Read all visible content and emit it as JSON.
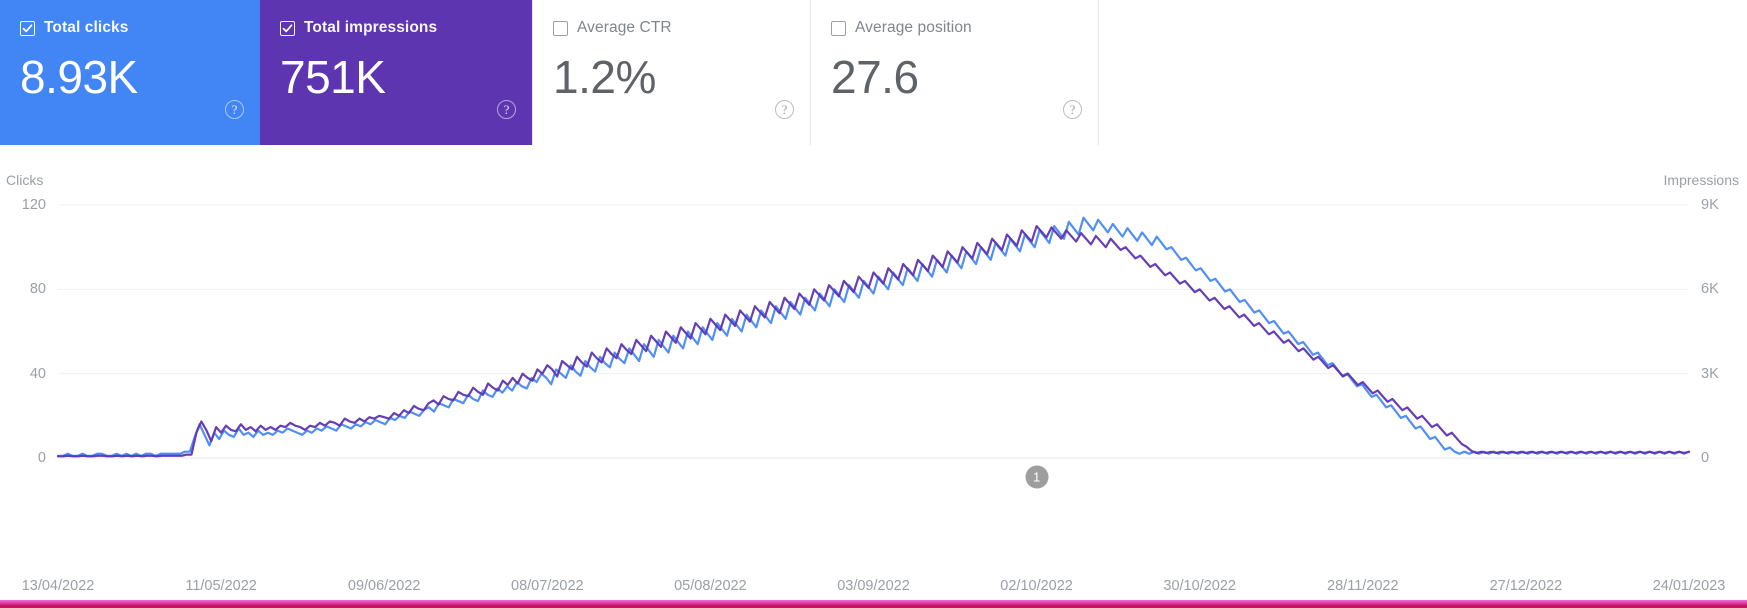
{
  "metrics": [
    {
      "id": "total-clicks",
      "label": "Total clicks",
      "value": "8.93K",
      "checked": true,
      "color": "#4285f4",
      "help": "?"
    },
    {
      "id": "total-impressions",
      "label": "Total impressions",
      "value": "751K",
      "checked": true,
      "color": "#5e35b1",
      "help": "?"
    },
    {
      "id": "average-ctr",
      "label": "Average CTR",
      "value": "1.2%",
      "checked": false,
      "color": "#ffffff",
      "help": "?"
    },
    {
      "id": "average-position",
      "label": "Average position",
      "value": "27.6",
      "checked": false,
      "color": "#ffffff",
      "help": "?"
    }
  ],
  "annotation": {
    "label": "1",
    "date": "02/10/2022"
  },
  "chart_data": {
    "type": "line",
    "title": "",
    "xlabel": "",
    "grid": true,
    "legend_position": "top-cards",
    "x_tick_labels": [
      "13/04/2022",
      "11/05/2022",
      "09/06/2022",
      "08/07/2022",
      "05/08/2022",
      "03/09/2022",
      "02/10/2022",
      "30/10/2022",
      "28/11/2022",
      "27/12/2022",
      "24/01/2023"
    ],
    "axes": [
      {
        "side": "left",
        "label": "Clicks",
        "ticks": [
          "0",
          "40",
          "80",
          "120"
        ],
        "tick_values": [
          0,
          40,
          80,
          120
        ],
        "range": [
          0,
          120
        ]
      },
      {
        "side": "right",
        "label": "Impressions",
        "ticks": [
          "0",
          "3K",
          "6K",
          "9K"
        ],
        "tick_values": [
          0,
          3000,
          6000,
          9000
        ],
        "range": [
          0,
          9000
        ]
      }
    ],
    "series": [
      {
        "name": "Clicks",
        "color": "#4285f4",
        "axis": "left",
        "values": [
          1,
          1,
          2,
          1,
          1,
          2,
          1,
          1,
          2,
          2,
          1,
          1,
          2,
          1,
          2,
          1,
          2,
          1,
          2,
          2,
          1,
          2,
          2,
          2,
          2,
          2,
          3,
          3,
          10,
          16,
          11,
          6,
          12,
          9,
          13,
          11,
          10,
          14,
          11,
          12,
          10,
          13,
          11,
          12,
          11,
          13,
          12,
          14,
          13,
          12,
          11,
          13,
          12,
          14,
          13,
          15,
          14,
          13,
          16,
          15,
          14,
          16,
          15,
          17,
          16,
          18,
          17,
          16,
          19,
          18,
          20,
          19,
          22,
          21,
          20,
          23,
          24,
          22,
          26,
          25,
          24,
          28,
          27,
          26,
          30,
          28,
          27,
          32,
          30,
          29,
          33,
          31,
          34,
          32,
          36,
          34,
          33,
          38,
          36,
          40,
          38,
          35,
          42,
          40,
          38,
          44,
          41,
          39,
          46,
          43,
          41,
          48,
          45,
          43,
          50,
          47,
          45,
          52,
          49,
          46,
          54,
          51,
          48,
          56,
          53,
          50,
          58,
          55,
          52,
          60,
          57,
          54,
          62,
          59,
          56,
          64,
          61,
          58,
          66,
          63,
          60,
          68,
          65,
          62,
          70,
          67,
          64,
          72,
          69,
          66,
          74,
          71,
          68,
          76,
          73,
          70,
          78,
          75,
          72,
          80,
          77,
          74,
          82,
          79,
          76,
          84,
          81,
          78,
          86,
          83,
          80,
          88,
          85,
          82,
          90,
          87,
          84,
          92,
          89,
          86,
          94,
          91,
          88,
          96,
          93,
          90,
          98,
          95,
          92,
          100,
          97,
          94,
          102,
          99,
          96,
          104,
          101,
          98,
          106,
          103,
          100,
          108,
          105,
          102,
          110,
          107,
          104,
          112,
          109,
          106,
          114,
          111,
          108,
          113,
          110,
          107,
          111,
          108,
          105,
          109,
          106,
          103,
          107,
          104,
          101,
          105,
          102,
          99,
          100,
          97,
          94,
          95,
          92,
          89,
          90,
          87,
          84,
          85,
          82,
          79,
          80,
          77,
          74,
          75,
          72,
          69,
          70,
          67,
          64,
          65,
          62,
          59,
          60,
          57,
          54,
          55,
          52,
          49,
          50,
          47,
          44,
          45,
          42,
          39,
          40,
          37,
          34,
          35,
          32,
          29,
          30,
          27,
          24,
          25,
          22,
          19,
          20,
          17,
          14,
          15,
          12,
          9,
          10,
          7,
          4,
          5,
          3,
          2,
          3,
          2,
          3,
          2,
          3,
          2,
          3,
          2,
          3,
          2,
          3,
          2,
          3,
          2,
          3,
          2,
          3,
          2,
          3,
          2,
          3,
          2,
          3,
          2,
          3,
          2,
          3,
          2,
          3,
          2,
          3,
          2,
          3,
          2,
          3,
          2,
          3,
          2,
          3,
          2,
          3,
          2,
          3,
          2,
          3,
          2,
          3
        ]
      },
      {
        "name": "Impressions",
        "color": "#5e35b1",
        "axis": "right",
        "values": [
          60,
          60,
          80,
          60,
          60,
          80,
          60,
          60,
          80,
          80,
          60,
          60,
          80,
          60,
          80,
          60,
          80,
          60,
          80,
          80,
          60,
          80,
          80,
          80,
          80,
          80,
          120,
          120,
          900,
          1300,
          1000,
          600,
          1100,
          900,
          1150,
          1000,
          950,
          1200,
          1000,
          1100,
          950,
          1150,
          1000,
          1100,
          1000,
          1150,
          1100,
          1250,
          1150,
          1100,
          1000,
          1150,
          1100,
          1250,
          1150,
          1300,
          1250,
          1150,
          1400,
          1300,
          1250,
          1400,
          1300,
          1450,
          1400,
          1500,
          1450,
          1400,
          1600,
          1500,
          1700,
          1600,
          1850,
          1750,
          1700,
          1950,
          2050,
          1900,
          2200,
          2100,
          2050,
          2350,
          2250,
          2200,
          2500,
          2350,
          2250,
          2650,
          2500,
          2400,
          2750,
          2600,
          2850,
          2650,
          3000,
          2850,
          2750,
          3150,
          3000,
          3300,
          3150,
          2900,
          3450,
          3300,
          3150,
          3600,
          3400,
          3250,
          3750,
          3550,
          3400,
          3900,
          3700,
          3550,
          4050,
          3850,
          3700,
          4200,
          4000,
          3800,
          4350,
          4150,
          3950,
          4500,
          4300,
          4100,
          4650,
          4450,
          4250,
          4800,
          4600,
          4400,
          4950,
          4750,
          4550,
          5100,
          4900,
          4700,
          5250,
          5050,
          4850,
          5400,
          5200,
          5000,
          5550,
          5350,
          5150,
          5700,
          5500,
          5300,
          5850,
          5650,
          5450,
          6000,
          5800,
          5600,
          6150,
          5950,
          5750,
          6300,
          6100,
          5900,
          6450,
          6250,
          6050,
          6600,
          6400,
          6200,
          6750,
          6550,
          6350,
          6900,
          6700,
          6500,
          7050,
          6850,
          6650,
          7200,
          7000,
          6800,
          7350,
          7150,
          6950,
          7500,
          7300,
          7100,
          7650,
          7450,
          7250,
          7800,
          7600,
          7400,
          7950,
          7750,
          7550,
          8100,
          7900,
          7700,
          8250,
          8050,
          7850,
          8200,
          8000,
          7800,
          8100,
          7900,
          7700,
          8000,
          7800,
          7600,
          7900,
          7700,
          7500,
          7800,
          7600,
          7400,
          7500,
          7300,
          7100,
          7200,
          7000,
          6800,
          6900,
          6700,
          6500,
          6600,
          6400,
          6200,
          6300,
          6100,
          5900,
          6000,
          5800,
          5600,
          5700,
          5500,
          5300,
          5400,
          5200,
          5000,
          5100,
          4900,
          4700,
          4800,
          4600,
          4400,
          4500,
          4300,
          4100,
          4200,
          4000,
          3800,
          3900,
          3700,
          3500,
          3600,
          3400,
          3200,
          3300,
          3100,
          2900,
          3000,
          2800,
          2600,
          2700,
          2500,
          2300,
          2400,
          2200,
          2000,
          2100,
          1900,
          1700,
          1800,
          1600,
          1400,
          1500,
          1300,
          1100,
          1200,
          1000,
          800,
          900,
          700,
          500,
          400,
          250,
          180,
          220,
          180,
          220,
          180,
          220,
          180,
          220,
          180,
          220,
          180,
          220,
          180,
          220,
          180,
          220,
          180,
          220,
          180,
          220,
          180,
          220,
          180,
          220,
          180,
          220,
          180,
          220,
          180,
          220,
          180,
          220,
          180,
          220,
          180,
          220,
          180,
          220,
          180,
          220,
          180,
          220,
          180,
          220
        ]
      }
    ]
  }
}
